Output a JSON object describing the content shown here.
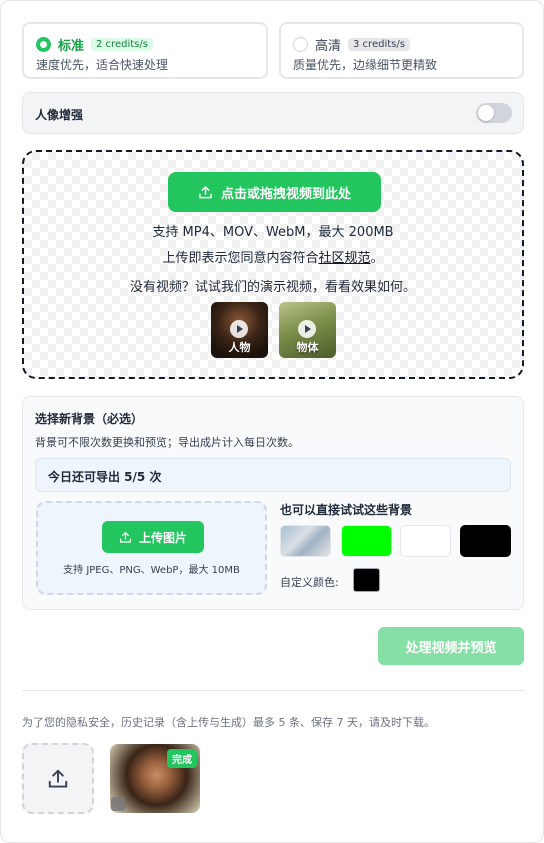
{
  "quality": {
    "standard": {
      "name": "标准",
      "credits": "2 credits/s",
      "desc": "速度优先，适合快速处理"
    },
    "hd": {
      "name": "高清",
      "credits": "3 credits/s",
      "desc": "质量优先，边缘细节更精致"
    }
  },
  "portrait_enhance": {
    "label": "人像增强"
  },
  "upload": {
    "button_label": "点击或拖拽视频到此处",
    "formats": "支持 MP4、MOV、WebM，最大 200MB",
    "consent_prefix": "上传即表示您同意内容符合",
    "consent_link": "社区规范",
    "consent_suffix": "。",
    "demo_prompt": "没有视频？试试我们的演示视频，看看效果如何。",
    "demos": [
      {
        "label": "人物"
      },
      {
        "label": "物体"
      }
    ]
  },
  "background": {
    "title": "选择新背景（必选）",
    "subtitle": "背景可不限次数更换和预览；导出成片计入每日次数。",
    "quota": "今日还可导出 5/5 次",
    "upload_label": "上传图片",
    "upload_hint": "支持 JPEG、PNG、WebP，最大 10MB",
    "try_title": "也可以直接试试这些背景",
    "swatches": [
      "image",
      "#00ff00",
      "#ffffff",
      "#000000"
    ],
    "custom_label": "自定义颜色:",
    "custom_color": "#000000"
  },
  "process_button": "处理视频并预览",
  "privacy_note": "为了您的隐私安全，历史记录（含上传与生成）最多 5 条、保存 7 天，请及时下载。",
  "history": [
    {
      "status": "完成"
    }
  ],
  "colors": {
    "accent": "#22c55e",
    "accent_disabled": "#86e0a6"
  }
}
